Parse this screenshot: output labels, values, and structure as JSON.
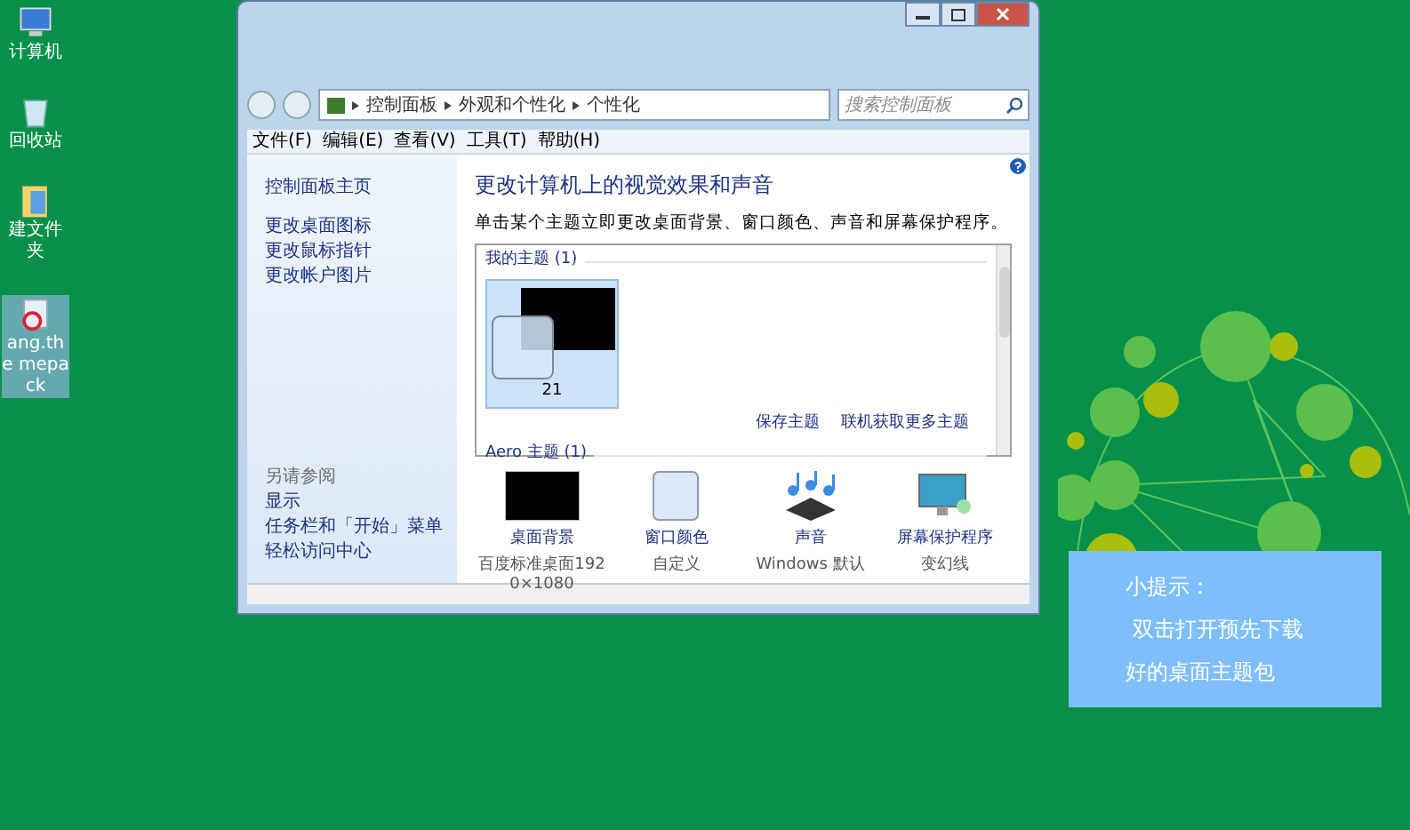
{
  "desktop_icons": [
    {
      "kind": "computer",
      "label": "计算机",
      "selected": false
    },
    {
      "kind": "recycle",
      "label": "回收站",
      "selected": false
    },
    {
      "kind": "folder",
      "label": "建文件夹",
      "selected": false
    },
    {
      "kind": "file",
      "label": "ang.the mepack",
      "selected": true
    }
  ],
  "window": {
    "address": [
      "控制面板",
      "外观和个性化",
      "个性化"
    ],
    "search_placeholder": "搜索控制面板",
    "menu": [
      "文件(F)",
      "编辑(E)",
      "查看(V)",
      "工具(T)",
      "帮助(H)"
    ],
    "sidebar": {
      "home": "控制面板主页",
      "links": [
        "更改桌面图标",
        "更改鼠标指针",
        "更改帐户图片"
      ],
      "see_also_title": "另请参阅",
      "see_also": [
        "显示",
        "任务栏和「开始」菜单",
        "轻松访问中心"
      ]
    },
    "heading": "更改计算机上的视觉效果和声音",
    "description": "单击某个主题立即更改桌面背景、窗口颜色、声音和屏幕保护程序。",
    "theme_groups": [
      {
        "title": "我的主题 (1)",
        "items": [
          {
            "name": "21",
            "selected": true
          }
        ]
      },
      {
        "title": "Aero 主题 (1)"
      }
    ],
    "theme_links": [
      "保存主题",
      "联机获取更多主题"
    ],
    "settings": [
      {
        "kind": "background",
        "title": "桌面背景",
        "value": "百度标准桌面1920×1080"
      },
      {
        "kind": "color",
        "title": "窗口颜色",
        "value": "自定义"
      },
      {
        "kind": "sound",
        "title": "声音",
        "value": "Windows 默认"
      },
      {
        "kind": "screensaver",
        "title": "屏幕保护程序",
        "value": "变幻线"
      }
    ]
  },
  "tip": {
    "title": "小提示：",
    "lines": [
      "双击打开预先下载",
      "好的桌面主题包"
    ]
  }
}
